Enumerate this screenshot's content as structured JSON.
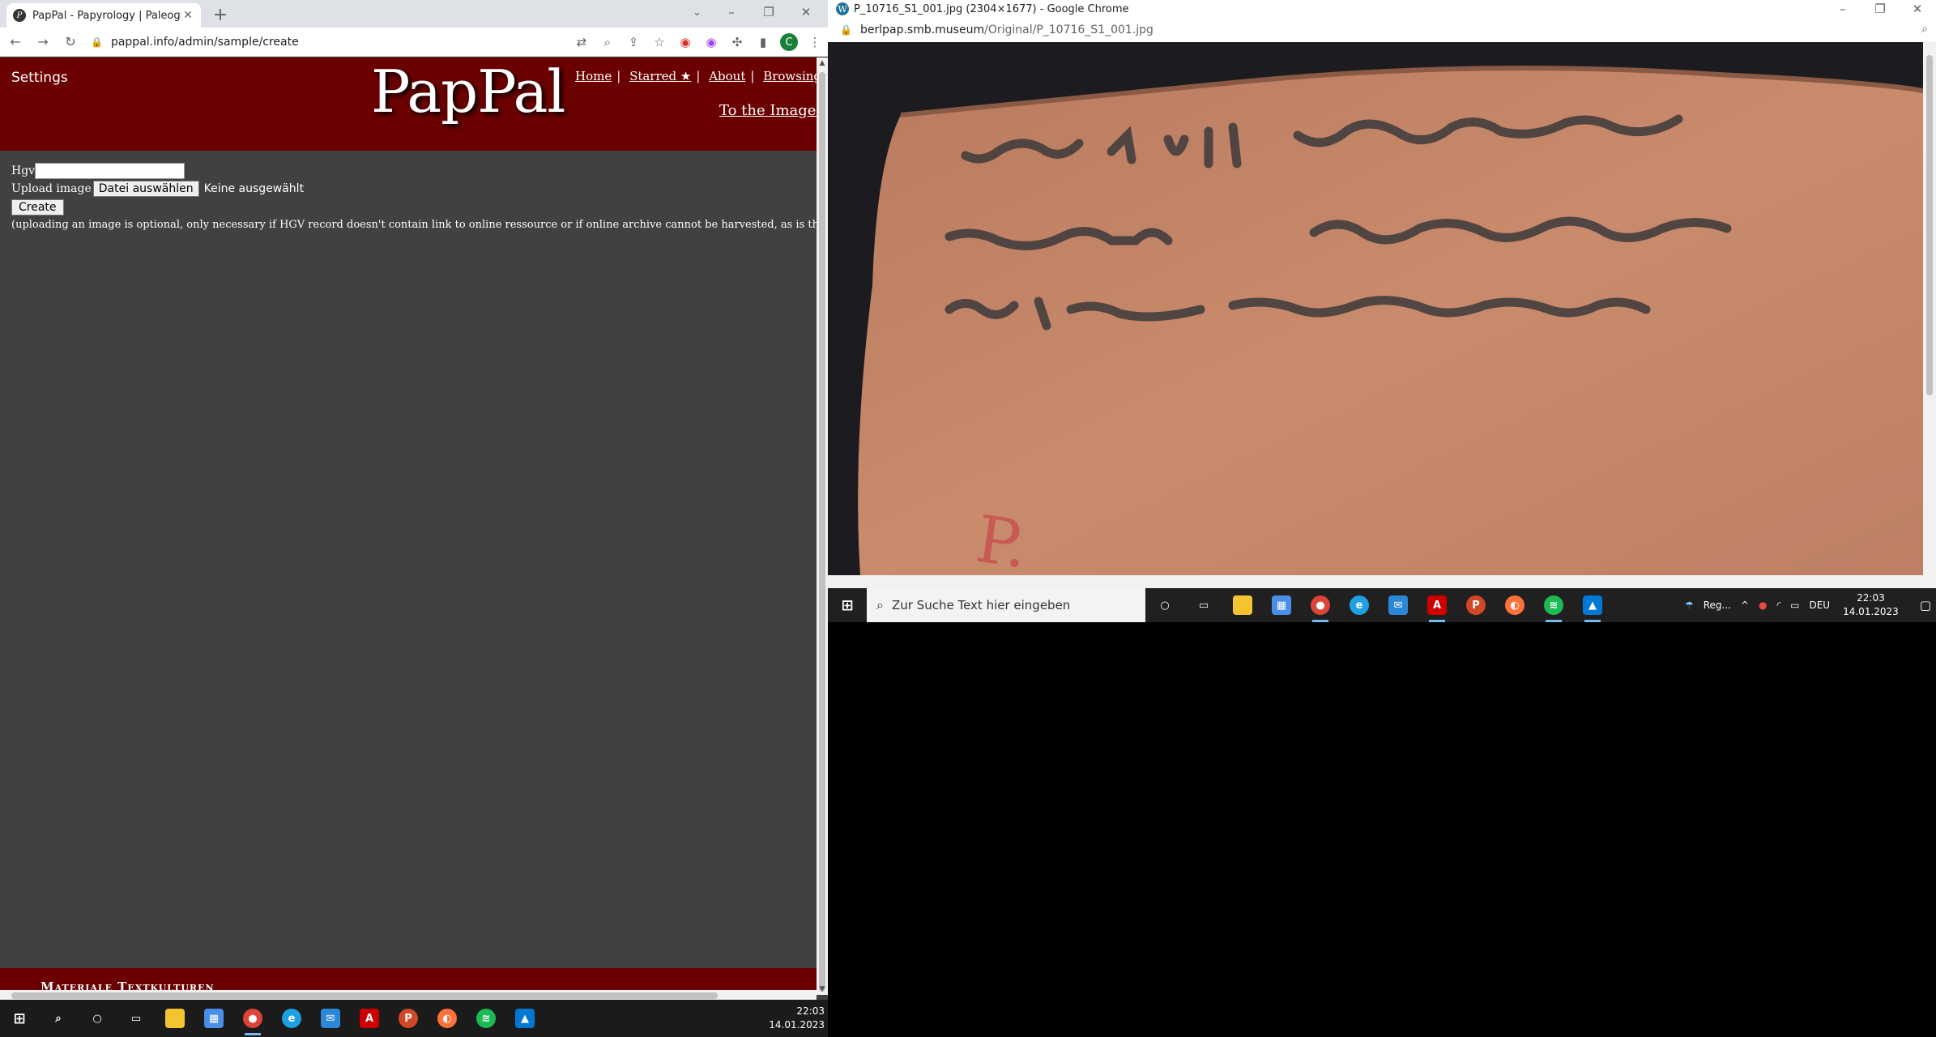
{
  "left_browser": {
    "tab_title": "PapPal - Papyrology | Paleograph",
    "url": "pappal.info/admin/sample/create",
    "avatar_letter": "C"
  },
  "site": {
    "settings": "Settings",
    "logo": "PapPal",
    "nav": [
      "Home",
      "Starred ★",
      "About",
      "Browsing Tips"
    ],
    "to_images": "To the Images ...",
    "footer": "Materiale Textkulturen"
  },
  "form": {
    "hgv_label": "Hgv",
    "upload_label": "Upload image",
    "file_button": "Datei auswählen",
    "no_file": "Keine ausgewählt",
    "create_button": "Create",
    "note": "(uploading an image is optional, only necessary if HGV record doesn't contain link to online ressource or if online archive cannot be harvested, as is the case for"
  },
  "left_taskbar": {
    "time": "22:03",
    "date": "14.01.2023"
  },
  "right_browser": {
    "title": "P_10716_S1_001.jpg (2304×1677) - Google Chrome",
    "url_host": "berlpap.smb.museum",
    "url_path": "/Original/P_10716_S1_001.jpg"
  },
  "right_taskbar": {
    "search_placeholder": "Zur Suche Text hier eingeben",
    "weather": "Reg...",
    "lang": "DEU",
    "time": "22:03",
    "date": "14.01.2023"
  },
  "colors": {
    "header_red": "#6b0000",
    "page_bg": "#414141",
    "ostracon": "#c98b6c"
  }
}
